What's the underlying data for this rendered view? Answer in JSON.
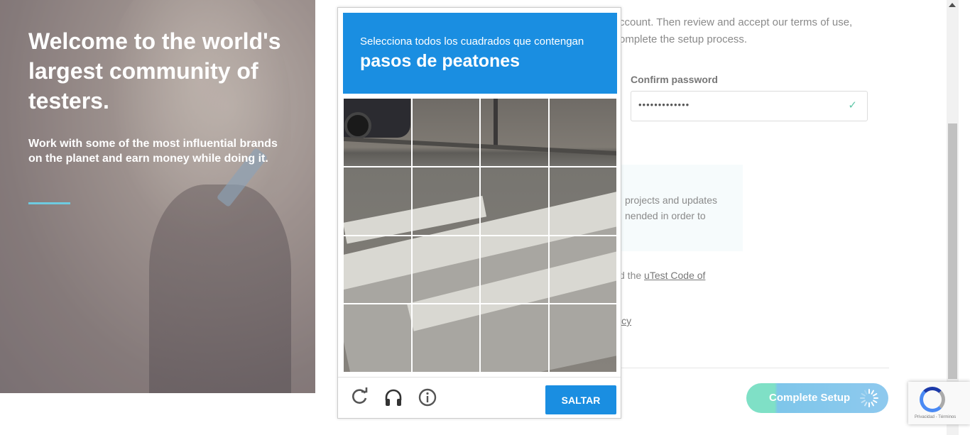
{
  "hero": {
    "title": "Welcome to the world's largest community of testers.",
    "subtitle": "Work with some of the most influential brands on the planet and earn money while doing it."
  },
  "form": {
    "intro_line1": "ccount. Then review and accept our terms of use,",
    "intro_line2": "omplete the setup process.",
    "confirm_password_label": "Confirm password",
    "confirm_password_value": "•••••••••••••",
    "notice_line1": "projects and updates",
    "notice_line2": "nended in order to",
    "code_prefix": "d the ",
    "code_link": "uTest Code of",
    "policy_fragment": "icy",
    "complete_setup_label": "Complete Setup"
  },
  "captcha": {
    "instruction": "Selecciona todos los cuadrados que contengan",
    "object": "pasos de peatones",
    "verify_label": "SALTAR",
    "icons": [
      "reload-icon",
      "headphones-icon",
      "info-icon"
    ]
  },
  "recaptcha_badge": {
    "links": "Privacidad - Términos"
  },
  "colors": {
    "captcha_blue": "#1a8ee1",
    "accent_teal": "#7fe0c6",
    "hero_bar": "#6ecbe0"
  }
}
